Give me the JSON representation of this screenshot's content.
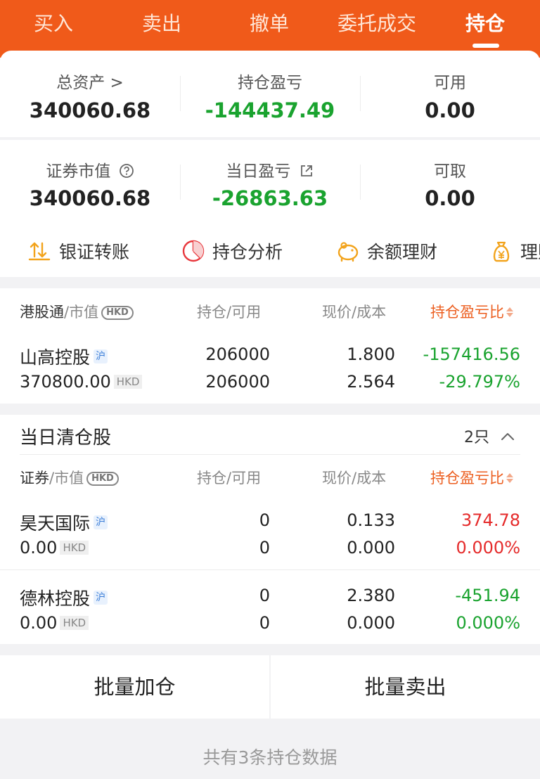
{
  "tabs": [
    {
      "label": "买入"
    },
    {
      "label": "卖出"
    },
    {
      "label": "撤单"
    },
    {
      "label": "委托成交"
    },
    {
      "label": "持仓"
    }
  ],
  "summary": {
    "total_assets": {
      "label": "总资产 >",
      "value": "340060.68"
    },
    "position_pnl": {
      "label": "持仓盈亏",
      "value": "-144437.49"
    },
    "available": {
      "label": "可用",
      "value": "0.00"
    },
    "market_value": {
      "label": "证券市值",
      "value": "340060.68"
    },
    "daily_pnl": {
      "label": "当日盈亏",
      "value": "-26863.63"
    },
    "withdrawable": {
      "label": "可取",
      "value": "0.00"
    }
  },
  "quick_actions": [
    {
      "label": "银证转账",
      "icon": "transfer-icon"
    },
    {
      "label": "持仓分析",
      "icon": "pie-chart-icon"
    },
    {
      "label": "余额理财",
      "icon": "piggy-bank-icon"
    },
    {
      "label": "理财",
      "icon": "money-bag-icon"
    }
  ],
  "holdings": {
    "header": {
      "col1_main": "港股通",
      "col1_sub": "/市值",
      "badge": "HKD",
      "col2": "持仓/可用",
      "col3": "现价/成本",
      "col4": "持仓盈亏比"
    },
    "rows": [
      {
        "name": "山高控股",
        "tag": "沪",
        "market_value": "370800.00",
        "unit": "HKD",
        "position": "206000",
        "available": "206000",
        "price": "1.800",
        "cost": "2.564",
        "pnl": "-157416.56",
        "pnl_pct": "-29.797%"
      }
    ]
  },
  "cleared": {
    "title": "当日清仓股",
    "count": "2只",
    "header": {
      "col1_main": "证券",
      "col1_sub": "/市值",
      "badge": "HKD",
      "col2": "持仓/可用",
      "col3": "现价/成本",
      "col4": "持仓盈亏比"
    },
    "rows": [
      {
        "name": "昊天国际",
        "tag": "沪",
        "market_value": "0.00",
        "unit": "HKD",
        "position": "0",
        "available": "0",
        "price": "0.133",
        "cost": "0.000",
        "pnl": "374.78",
        "pnl_pct": "0.000%"
      },
      {
        "name": "德林控股",
        "tag": "沪",
        "market_value": "0.00",
        "unit": "HKD",
        "position": "0",
        "available": "0",
        "price": "2.380",
        "cost": "0.000",
        "pnl": "-451.94",
        "pnl_pct": "0.000%"
      }
    ]
  },
  "actions": {
    "batch_add": "批量加仓",
    "batch_sell": "批量卖出"
  },
  "footer": "共有3条持仓数据",
  "colors": {
    "brand": "#f05a1a",
    "gain": "#e52b2b",
    "loss": "#1aa32f"
  }
}
